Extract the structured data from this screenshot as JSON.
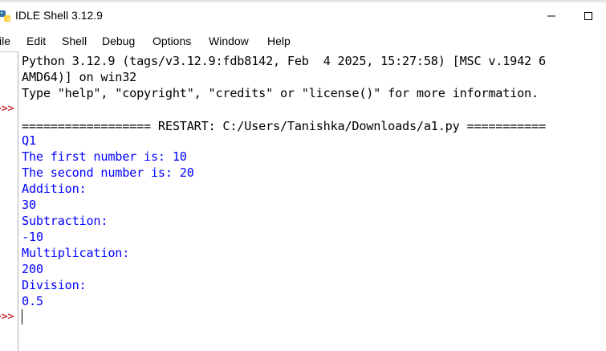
{
  "window": {
    "title": "IDLE Shell 3.12.9"
  },
  "menu": {
    "items": [
      "ile",
      "Edit",
      "Shell",
      "Debug",
      "Options",
      "Window",
      "Help"
    ]
  },
  "gutter": {
    "prompt_marker": ">>>"
  },
  "shell": {
    "banner": [
      "Python 3.12.9 (tags/v3.12.9:fdb8142, Feb  4 2025, 15:27:58) [MSC v.1942 6",
      "AMD64)] on win32",
      "Type \"help\", \"copyright\", \"credits\" or \"license()\" for more information."
    ],
    "restart_line": "================== RESTART: C:/Users/Tanishka/Downloads/a1.py ===========",
    "output": [
      "Q1",
      "The first number is: 10",
      "The second number is: 20",
      "Addition:",
      "30",
      "Subtraction:",
      "-10",
      "Multiplication:",
      "200",
      "Division:",
      "0.5"
    ]
  },
  "colors": {
    "stdout": "#0000ff",
    "prompt": "#c00000",
    "text": "#000000"
  },
  "icons": {
    "app": "python-idle-icon",
    "minimize": "minimize-icon",
    "maximize": "maximize-icon"
  }
}
